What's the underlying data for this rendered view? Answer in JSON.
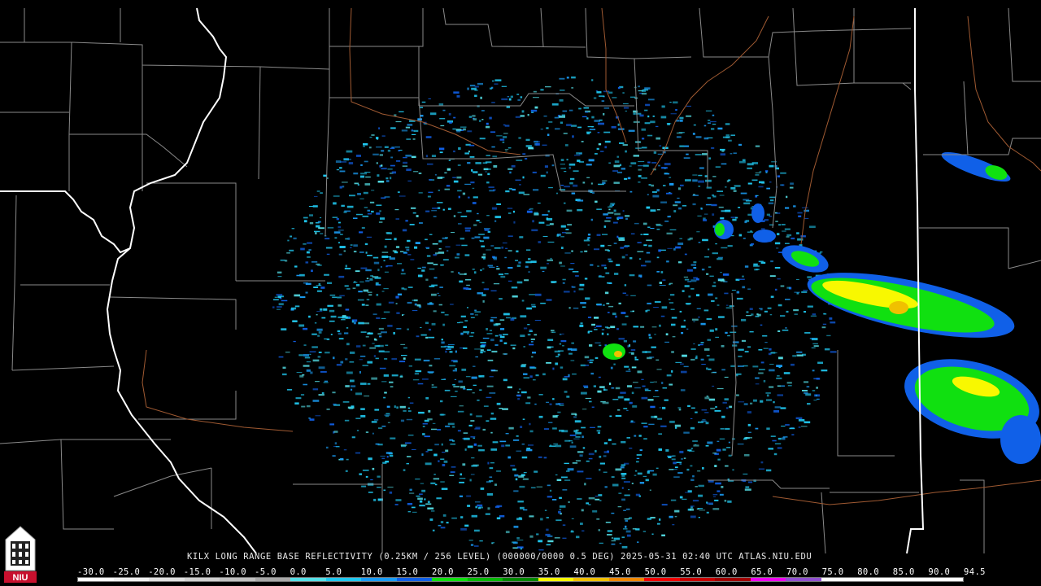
{
  "caption": "KILX LONG RANGE BASE REFLECTIVITY (0.25KM / 256 LEVEL) (000000/0000 0.5 DEG) 2025-05-31 02:40 UTC  ATLAS.NIU.EDU",
  "color_scale": {
    "labels": [
      "-30.0",
      "-25.0",
      "-20.0",
      "-15.0",
      "-10.0",
      "-5.0",
      "0.0",
      "5.0",
      "10.0",
      "15.0",
      "20.0",
      "25.0",
      "30.0",
      "35.0",
      "40.0",
      "45.0",
      "50.0",
      "55.0",
      "60.0",
      "65.0",
      "70.0",
      "75.0",
      "80.0",
      "85.0",
      "90.0",
      "94.5"
    ],
    "colors": [
      "#ffffff",
      "#f0f0f0",
      "#e0e0e0",
      "#d0d0d0",
      "#c0c0c0",
      "#a8a8a8",
      "#55e0e8",
      "#20c8f0",
      "#1a9cf5",
      "#1060e8",
      "#10e010",
      "#08b808",
      "#008800",
      "#f8f800",
      "#f0c000",
      "#f08800",
      "#f00000",
      "#c80000",
      "#a00000",
      "#f000f0",
      "#9050d0",
      "#ffffff",
      "#ffffff",
      "#ffffff",
      "#ffffff"
    ]
  },
  "logo": {
    "text": "NIU",
    "icon": "niu-tower-logo-icon"
  },
  "map": {
    "radar_site": "KILX",
    "background": "#000000",
    "state_border_color": "#ffffff",
    "county_line_color": "#8a8a8a",
    "river_color": "#a05a32"
  }
}
